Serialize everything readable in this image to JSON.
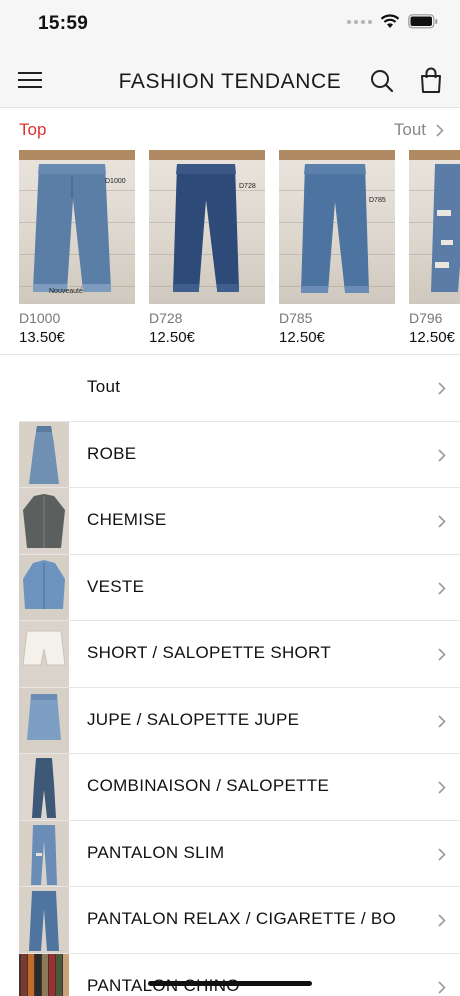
{
  "status_bar": {
    "time": "15:59"
  },
  "header": {
    "title": "FASHION TENDANCE"
  },
  "top_section": {
    "title": "Top",
    "see_all": "Tout",
    "products": [
      {
        "code": "D1000",
        "price": "13.50€",
        "tag": "D1000",
        "sticker": "Nouveauté"
      },
      {
        "code": "D728",
        "price": "12.50€",
        "tag": "D728"
      },
      {
        "code": "D785",
        "price": "12.50€",
        "tag": "D785"
      },
      {
        "code": "D796",
        "price": "12.50€"
      }
    ]
  },
  "categories": [
    {
      "label": "Tout"
    },
    {
      "label": "ROBE"
    },
    {
      "label": "CHEMISE"
    },
    {
      "label": "VESTE"
    },
    {
      "label": "SHORT / SALOPETTE SHORT"
    },
    {
      "label": "JUPE / SALOPETTE JUPE"
    },
    {
      "label": "COMBINAISON / SALOPETTE"
    },
    {
      "label": "PANTALON SLIM"
    },
    {
      "label": "PANTALON RELAX / CIGARETTE / BO"
    },
    {
      "label": "PANTALON CHINO"
    }
  ],
  "colors": {
    "accent_red": "#e0302e",
    "denim": "#4f74a0"
  }
}
